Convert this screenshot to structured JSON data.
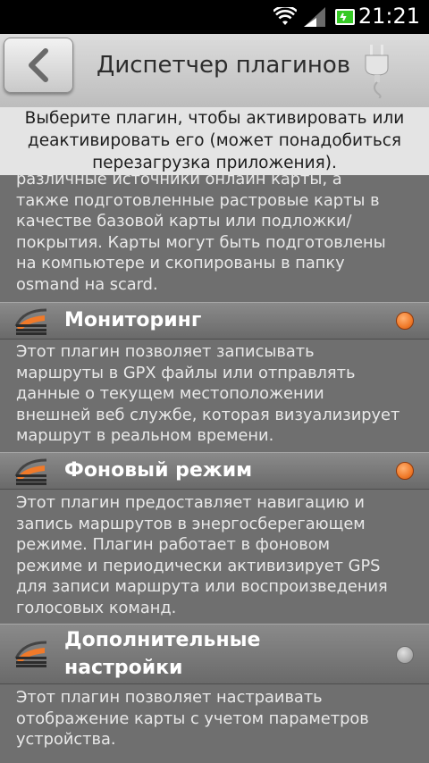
{
  "status_bar": {
    "time": "21:21"
  },
  "header": {
    "title": "Диспетчер плагинов"
  },
  "hint": {
    "line1": "Выберите плагин, чтобы активировать или",
    "line2": "деактивировать его (может понадобиться",
    "line3": "перезагрузка приложения)."
  },
  "top_desc": {
    "line1": "различные источники онлайн карты, а",
    "line2": "также подготовленные растровые карты в",
    "line3": "качестве базовой карты или подложки/",
    "line4": "покрытия. Карты могут быть подготовлены",
    "line5": "на компьютере и скопированы в папку",
    "line6": "osmand на scard."
  },
  "plugins": [
    {
      "title": "Мониторинг",
      "enabled": true,
      "desc": [
        "Этот плагин позволяет записывать",
        "маршруты в GPX файлы или отправлять",
        "данные о текущем местоположении",
        "внешней веб службе, которая визуализирует",
        "маршрут в реальном времени."
      ]
    },
    {
      "title": "Фоновый режим",
      "enabled": true,
      "desc": [
        "Этот плагин предоставляет навигацию и",
        "запись маршрутов в энергосберегающем",
        "режиме. Плагин работает в фоновом",
        "режиме и периодически активизирует GPS",
        "для записи маршрута или воспроизведения",
        "голосовых команд."
      ]
    },
    {
      "title_line1": "Дополнительные",
      "title_line2": "настройки",
      "enabled": false,
      "desc": [
        "Этот плагин позволяет настраивать",
        "отображение карты с учетом параметров",
        "устройства."
      ]
    }
  ],
  "colors": {
    "enabled_dot": "#f07a2a",
    "disabled_dot": "#b0b0b0"
  }
}
